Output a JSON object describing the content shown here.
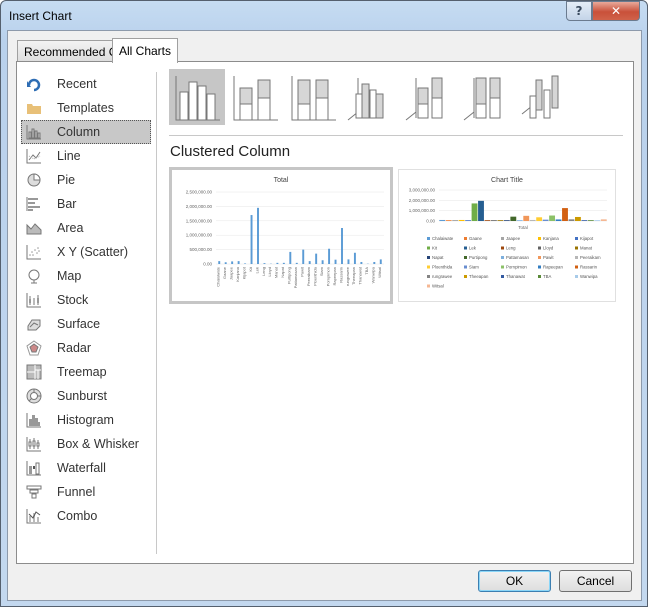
{
  "window": {
    "title": "Insert Chart",
    "help_label": "?",
    "close_label": "✕"
  },
  "tabs": [
    {
      "label": "Recommended Charts",
      "active": false
    },
    {
      "label": "All Charts",
      "active": true
    }
  ],
  "sidebar": {
    "items": [
      {
        "label": "Recent",
        "icon": "recent-icon"
      },
      {
        "label": "Templates",
        "icon": "folder-icon"
      },
      {
        "label": "Column",
        "icon": "column-chart-icon",
        "selected": true
      },
      {
        "label": "Line",
        "icon": "line-chart-icon"
      },
      {
        "label": "Pie",
        "icon": "pie-chart-icon"
      },
      {
        "label": "Bar",
        "icon": "bar-chart-icon"
      },
      {
        "label": "Area",
        "icon": "area-chart-icon"
      },
      {
        "label": "X Y (Scatter)",
        "icon": "scatter-chart-icon"
      },
      {
        "label": "Map",
        "icon": "map-chart-icon"
      },
      {
        "label": "Stock",
        "icon": "stock-chart-icon"
      },
      {
        "label": "Surface",
        "icon": "surface-chart-icon"
      },
      {
        "label": "Radar",
        "icon": "radar-chart-icon"
      },
      {
        "label": "Treemap",
        "icon": "treemap-chart-icon"
      },
      {
        "label": "Sunburst",
        "icon": "sunburst-chart-icon"
      },
      {
        "label": "Histogram",
        "icon": "histogram-chart-icon"
      },
      {
        "label": "Box & Whisker",
        "icon": "box-whisker-chart-icon"
      },
      {
        "label": "Waterfall",
        "icon": "waterfall-chart-icon"
      },
      {
        "label": "Funnel",
        "icon": "funnel-chart-icon"
      },
      {
        "label": "Combo",
        "icon": "combo-chart-icon"
      }
    ]
  },
  "subtypes": [
    {
      "name": "clustered-column",
      "selected": true
    },
    {
      "name": "stacked-column"
    },
    {
      "name": "100-stacked-column"
    },
    {
      "name": "3d-clustered-column"
    },
    {
      "name": "3d-stacked-column"
    },
    {
      "name": "3d-100-stacked-column"
    },
    {
      "name": "3d-column"
    }
  ],
  "selected_type_title": "Clustered Column",
  "buttons": {
    "ok": "OK",
    "cancel": "Cancel"
  },
  "chart_data": [
    {
      "type": "bar",
      "title": "Total",
      "categories": [
        "Chalaiwate",
        "Gaane",
        "Jaapee",
        "Kanjana",
        "Kijapot",
        "Kit",
        "Lek",
        "Leng",
        "Lloyd",
        "Manat",
        "Napat",
        "Purtipong",
        "Pattamasan",
        "Pawit",
        "Peeraikam",
        "Ploenthida",
        "Siam",
        "Pornpimon",
        "Rapeepan",
        "Rassarin",
        "rungrawee",
        "Theeapan",
        "Thanawat",
        "TBA",
        "Wanwipa",
        "Witsal"
      ],
      "values": [
        100000,
        60000,
        90000,
        100000,
        20000,
        1700000,
        1950000,
        30000,
        10000,
        40000,
        40000,
        420000,
        40000,
        500000,
        100000,
        360000,
        130000,
        530000,
        150000,
        1250000,
        160000,
        390000,
        70000,
        10000,
        70000,
        160000
      ],
      "yticks": [
        "0.00",
        "500,000.00",
        "1,000,000.00",
        "1,500,000.00",
        "2,000,000.00",
        "2,500,000.00"
      ],
      "ylim": [
        0,
        2500000
      ],
      "grid": true,
      "color": "#5b9bd5"
    },
    {
      "type": "bar",
      "title": "Chart Title",
      "xlabel": "Total",
      "yticks": [
        "0.00",
        "1,000,000.00",
        "2,000,000.00",
        "3,000,000.00"
      ],
      "ylim": [
        0,
        3000000
      ],
      "legend": "bottom",
      "series": [
        {
          "name": "Chalaiwate",
          "value": 100000,
          "color": "#5b9bd5"
        },
        {
          "name": "Gaane",
          "value": 60000,
          "color": "#ed7d31"
        },
        {
          "name": "Jaapee",
          "value": 90000,
          "color": "#a5a5a5"
        },
        {
          "name": "Kanjana",
          "value": 100000,
          "color": "#ffc000"
        },
        {
          "name": "Kijapot",
          "value": 20000,
          "color": "#4472c4"
        },
        {
          "name": "Kit",
          "value": 1700000,
          "color": "#70ad47"
        },
        {
          "name": "Lek",
          "value": 1950000,
          "color": "#255e91"
        },
        {
          "name": "Leng",
          "value": 30000,
          "color": "#9e480e"
        },
        {
          "name": "Lloyd",
          "value": 10000,
          "color": "#636363"
        },
        {
          "name": "Manat",
          "value": 40000,
          "color": "#997300"
        },
        {
          "name": "Napat",
          "value": 40000,
          "color": "#264478"
        },
        {
          "name": "Purtipong",
          "value": 420000,
          "color": "#43682b"
        },
        {
          "name": "Pattamasan",
          "value": 40000,
          "color": "#7cafdd"
        },
        {
          "name": "Pawit",
          "value": 500000,
          "color": "#f1975a"
        },
        {
          "name": "Peeraikam",
          "value": 100000,
          "color": "#b7b7b7"
        },
        {
          "name": "Ploenthida",
          "value": 360000,
          "color": "#ffcd33"
        },
        {
          "name": "Siam",
          "value": 130000,
          "color": "#698ed0"
        },
        {
          "name": "Pornpimon",
          "value": 530000,
          "color": "#8cc168"
        },
        {
          "name": "Rapeepan",
          "value": 150000,
          "color": "#327dc2"
        },
        {
          "name": "Rassarin",
          "value": 1250000,
          "color": "#d26012"
        },
        {
          "name": "rungrawee",
          "value": 160000,
          "color": "#848484"
        },
        {
          "name": "Theeapan",
          "value": 390000,
          "color": "#cc9a00"
        },
        {
          "name": "Thanawat",
          "value": 70000,
          "color": "#335aa1"
        },
        {
          "name": "TBA",
          "value": 10000,
          "color": "#5a8a39"
        },
        {
          "name": "Wanwipa",
          "value": 70000,
          "color": "#a8cbe9"
        },
        {
          "name": "Witsal",
          "value": 160000,
          "color": "#f5b793"
        }
      ]
    }
  ]
}
